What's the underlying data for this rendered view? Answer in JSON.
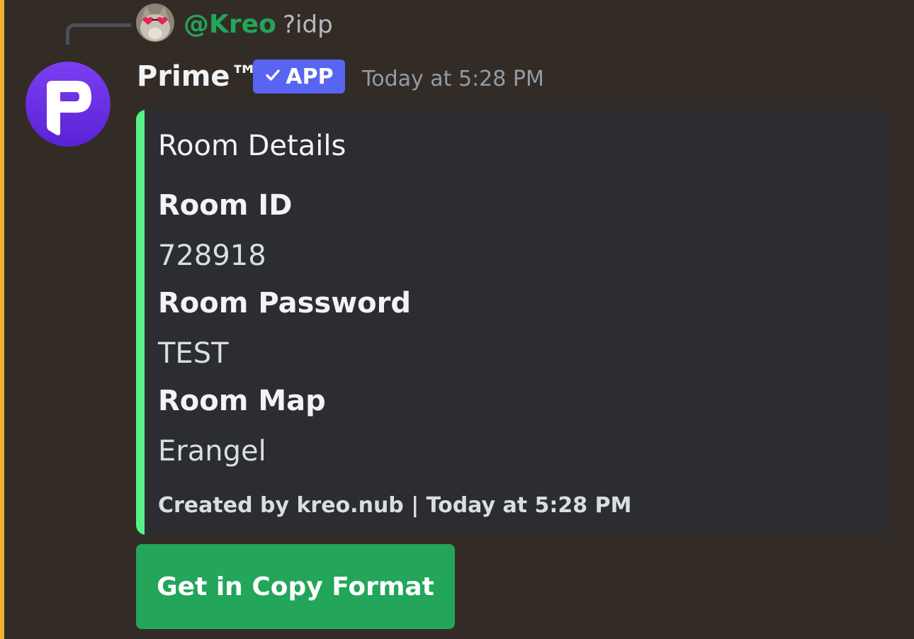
{
  "reply": {
    "username": "@Kreo",
    "text": "?idp"
  },
  "message": {
    "author": "Prime™",
    "badge_label": "APP",
    "badge_icon": "checkmark-icon",
    "timestamp": "Today at 5:28 PM"
  },
  "embed": {
    "title": "Room Details",
    "fields": [
      {
        "name": "Room ID",
        "value": "728918"
      },
      {
        "name": "Room Password",
        "value": "TEST"
      },
      {
        "name": "Room Map",
        "value": "Erangel"
      }
    ],
    "footer": "Created by kreo.nub | Today at 5:28 PM"
  },
  "button": {
    "label": "Get in Copy Format"
  },
  "colors": {
    "background": "#332c26",
    "mention_bar": "#f0b232",
    "reply_name": "#23a55a",
    "app_badge": "#5865f2",
    "embed_background": "#2b2d31",
    "embed_accent": "#57f287",
    "button": "#23a55a",
    "bot_avatar": "#6a2fe0"
  }
}
